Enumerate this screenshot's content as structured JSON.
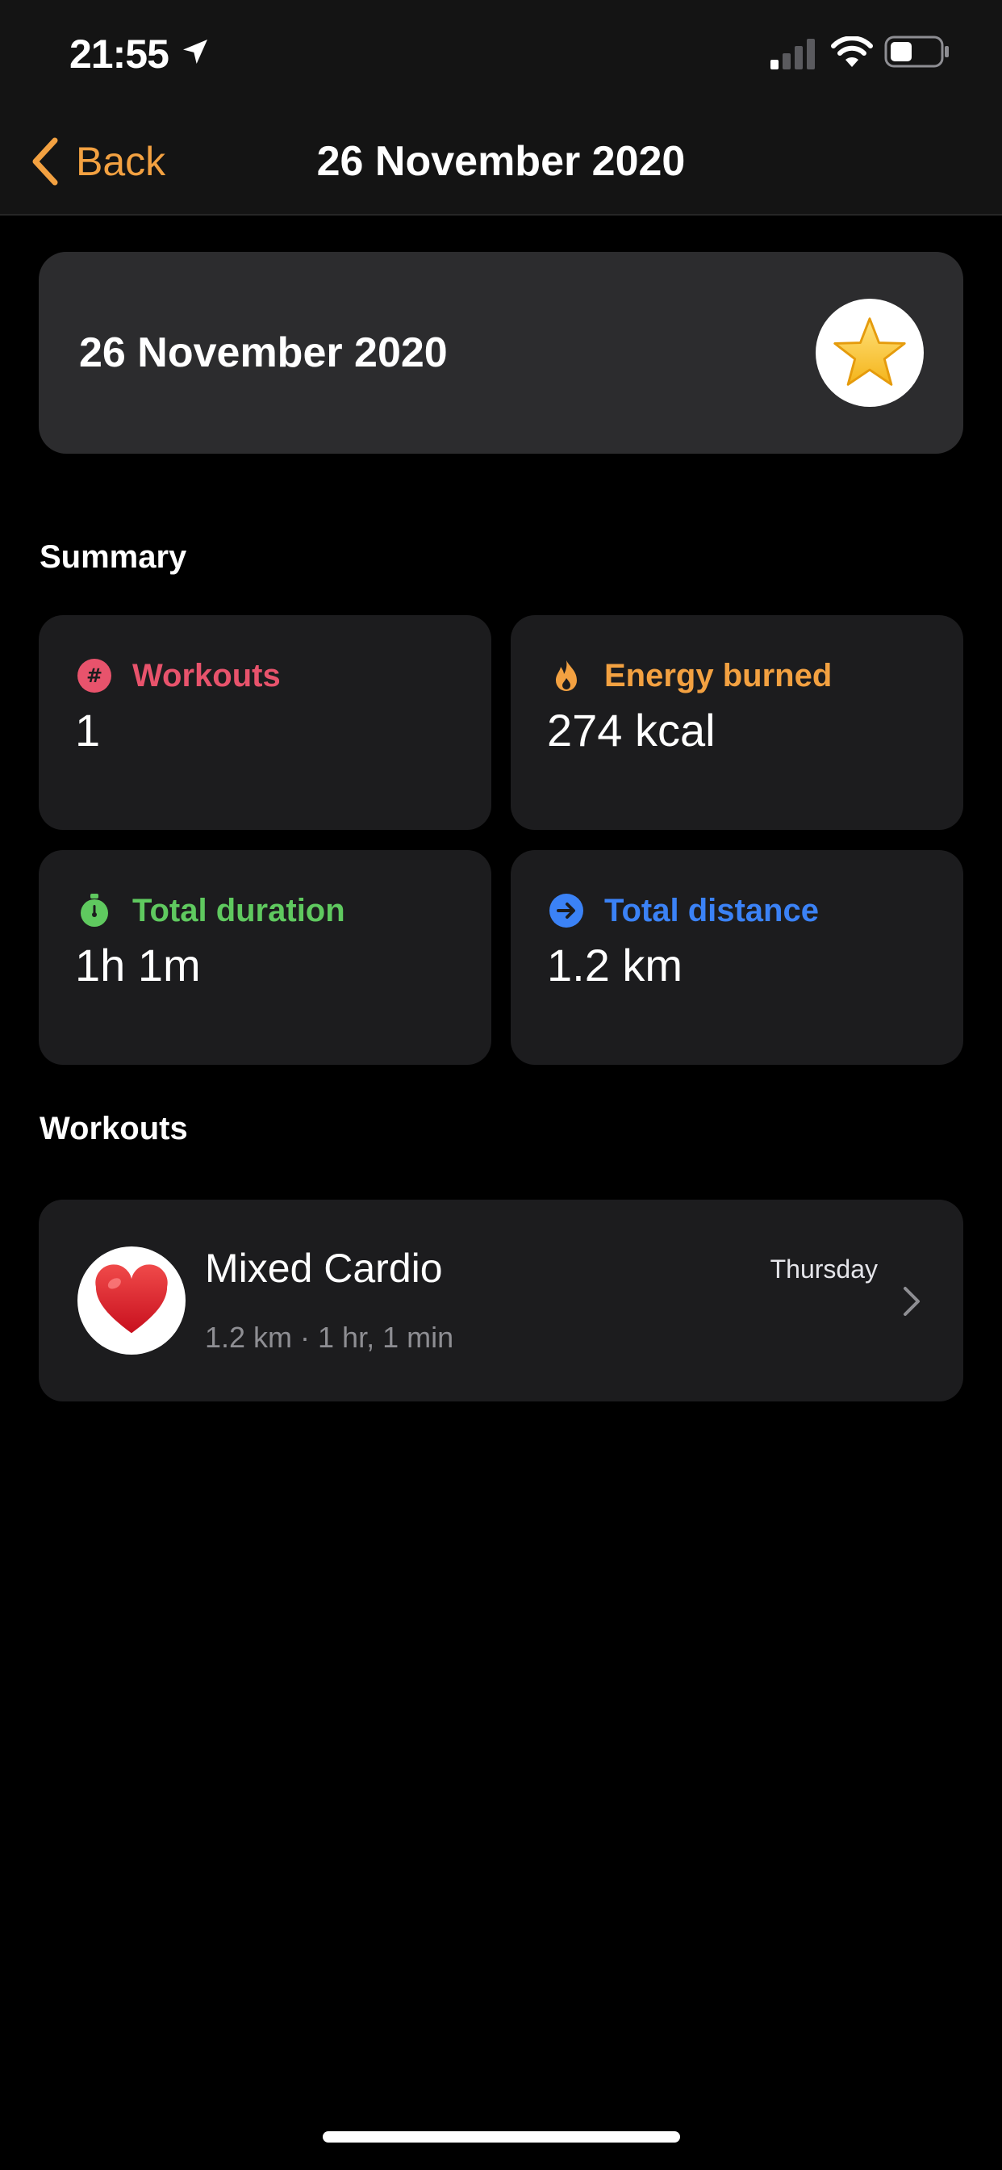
{
  "status_bar": {
    "time": "21:55"
  },
  "nav": {
    "back_label": "Back",
    "title": "26 November 2020"
  },
  "header_card": {
    "title": "26 November 2020",
    "icon": "star-icon"
  },
  "summary": {
    "label": "Summary",
    "stats": [
      {
        "label": "Workouts",
        "value": "1",
        "icon": "hash-icon",
        "color": "#e8536c"
      },
      {
        "label": "Energy burned",
        "value": "274 kcal",
        "icon": "flame-icon",
        "color": "#f3a141"
      },
      {
        "label": "Total duration",
        "value": "1h 1m",
        "icon": "stopwatch-icon",
        "color": "#5fc95f"
      },
      {
        "label": "Total distance",
        "value": "1.2 km",
        "icon": "arrow-right-icon",
        "color": "#3b82f6"
      }
    ]
  },
  "workouts": {
    "label": "Workouts",
    "items": [
      {
        "name": "Mixed Cardio",
        "meta": "1.2 km · 1 hr, 1 min",
        "day": "Thursday",
        "icon": "heart-icon"
      }
    ]
  },
  "colors": {
    "accent": "#f3a141",
    "card_background": "#1c1c1e",
    "header_card_background": "#2c2c2e",
    "bar_background": "#141414"
  }
}
